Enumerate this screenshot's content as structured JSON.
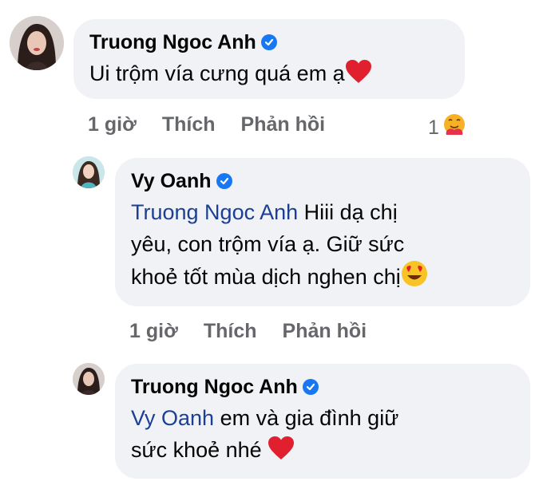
{
  "comments": [
    {
      "author": "Truong Ngoc Anh",
      "text": "Ui trộm vía cưng quá em ạ",
      "emoji": "heart-emoji",
      "time": "1 giờ",
      "like_label": "Thích",
      "reply_label": "Phản hồi",
      "reaction_count": "1",
      "reaction_icon": "hug-reaction-icon"
    },
    {
      "author": "Vy Oanh",
      "mention": "Truong Ngoc Anh",
      "text_line1": " Hiii dạ chị",
      "text_line2": "yêu, con trộm vía ạ. Giữ sức",
      "text_line3": "khoẻ tốt mùa dịch nghen chị",
      "emoji": "heart-eyes-emoji",
      "time": "1 giờ",
      "like_label": "Thích",
      "reply_label": "Phản hồi"
    },
    {
      "author": "Truong Ngoc Anh",
      "mention": "Vy Oanh",
      "text_line1": " em và gia đình giữ",
      "text_line2": "sức khoẻ nhé ",
      "emoji": "heart-emoji"
    }
  ],
  "colors": {
    "bubble": "#f0f2f5",
    "verified": "#1877f2",
    "mention": "#1c3f94",
    "meta": "#65676b"
  }
}
